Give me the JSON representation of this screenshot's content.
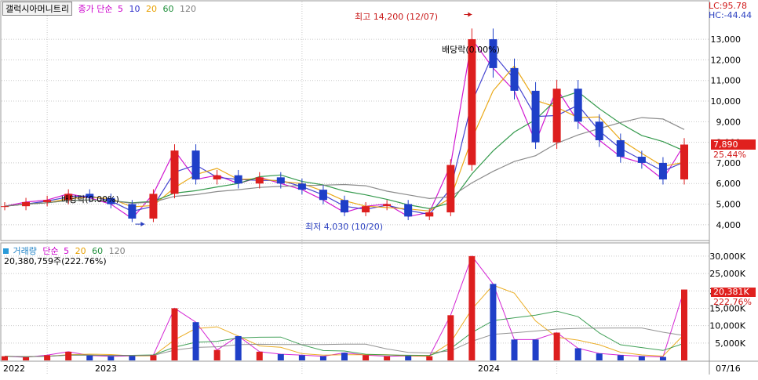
{
  "price_panel": {
    "stock_name": "갤럭시아머니트리",
    "ma_label": "종가 단순",
    "ma_periods": [
      "5",
      "10",
      "20",
      "60",
      "120"
    ],
    "ma_colors": [
      "#cc00cc",
      "#3333cc",
      "#e8a000",
      "#1f8f3a",
      "#808080"
    ],
    "lc_text": "LC:95.78",
    "hc_text": "HC:-44.44",
    "current_price": "7,890",
    "change_pct": "25.44%",
    "high_annotation": "최고 14,200 (12/07)",
    "low_annotation": "최저 4,030 (10/20)",
    "dividend_label_1": "배당락(0.00%)",
    "dividend_label_2": "배당락(0.00%)"
  },
  "volume_panel": {
    "label": "거래량",
    "ma_label": "단순",
    "ma_periods": [
      "5",
      "20",
      "60",
      "120"
    ],
    "ma_colors": [
      "#cc00cc",
      "#e8a000",
      "#1f8f3a",
      "#808080"
    ],
    "info": "20,380,759주(222.76%)",
    "current_volume": "20,381K",
    "current_pct": "222.76%"
  },
  "x_axis": {
    "labels": [
      "2022",
      "2023",
      "2024",
      "07/16"
    ]
  },
  "colors": {
    "up": "#dd1e1e",
    "down": "#1f3fc8",
    "grid": "#c8c8c8",
    "price_tag_bg": "#e0201e"
  },
  "chart_data": [
    {
      "type": "line",
      "title": "갤럭시아머니트리",
      "series": [
        {
          "name": "종가",
          "x": [
            "2021-11",
            "2021-12",
            "2022-01",
            "2022-02",
            "2022-03",
            "2022-04",
            "2022-05",
            "2022-06",
            "2022-07",
            "2022-08",
            "2022-09",
            "2022-10",
            "2022-11",
            "2022-12",
            "2023-01",
            "2023-02",
            "2023-03",
            "2023-04",
            "2023-05",
            "2023-06",
            "2023-07",
            "2023-08",
            "2023-09",
            "2023-10",
            "2023-11",
            "2023-12",
            "2024-01",
            "2024-02",
            "2024-03",
            "2024-04",
            "2024-05",
            "2024-06",
            "2024-07"
          ],
          "values": [
            4900,
            5100,
            5200,
            5500,
            5300,
            5000,
            4300,
            5500,
            7600,
            6200,
            6400,
            6000,
            6300,
            6000,
            5700,
            5200,
            4600,
            4900,
            5000,
            4400,
            4600,
            6900,
            13000,
            11600,
            10500,
            8000,
            10600,
            9000,
            8100,
            7300,
            7000,
            6200,
            7890
          ]
        }
      ],
      "yticks": [
        4000,
        5000,
        6000,
        7000,
        8000,
        9000,
        10000,
        11000,
        12000,
        13000
      ],
      "ylim": [
        3500,
        14600
      ],
      "high": {
        "value": 14200,
        "label": "12/07"
      },
      "low": {
        "value": 4030,
        "label": "10/20"
      }
    },
    {
      "type": "bar",
      "title": "거래량",
      "series": [
        {
          "name": "거래량",
          "x": [
            "2021-11",
            "2021-12",
            "2022-01",
            "2022-02",
            "2022-03",
            "2022-04",
            "2022-05",
            "2022-06",
            "2022-07",
            "2022-08",
            "2022-09",
            "2022-10",
            "2022-11",
            "2022-12",
            "2023-01",
            "2023-02",
            "2023-03",
            "2023-04",
            "2023-05",
            "2023-06",
            "2023-07",
            "2023-08",
            "2023-09",
            "2023-10",
            "2023-11",
            "2023-12",
            "2024-01",
            "2024-02",
            "2024-03",
            "2024-04",
            "2024-05",
            "2024-06",
            "2024-07"
          ],
          "values": [
            1200,
            900,
            1500,
            2500,
            1400,
            1200,
            1300,
            1500,
            15000,
            11000,
            3000,
            7000,
            2500,
            1800,
            1500,
            1200,
            2200,
            1500,
            1200,
            1300,
            1200,
            13000,
            30000,
            22000,
            6000,
            6000,
            8000,
            3500,
            2000,
            1500,
            1200,
            1000,
            20381
          ]
        }
      ],
      "yticks": [
        5000,
        10000,
        15000,
        20000,
        25000,
        30000
      ],
      "ytick_labels": [
        "5,000K",
        "10,000K",
        "15,000K",
        "20,000K",
        "25,000K",
        "30,000K"
      ],
      "ylim": [
        0,
        32000
      ]
    }
  ]
}
